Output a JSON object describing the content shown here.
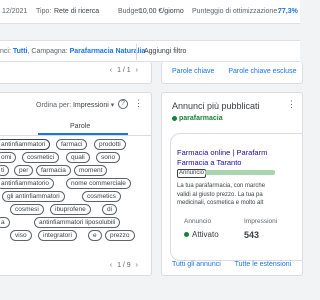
{
  "topbar": {
    "date_tail": "12/2021",
    "type_label": "Tipo:",
    "type_value": "Rete di ricerca",
    "budget_label": "Budget:",
    "budget_value": "10,00 €/giorno",
    "score_label": "Punteggio di ottimizzazione:",
    "score_value": "77,3%"
  },
  "filterbar": {
    "prefix": "nci:",
    "all": "Tutti",
    "campaign_label": "Campagna:",
    "campaign_value": "Parafarmacia Naturalia",
    "add_filter": "Aggiungi filtro"
  },
  "left_top": {
    "pager": "1 / 1",
    "prev": "‹",
    "next": "›"
  },
  "right_top": {
    "links": [
      "Parole chiave",
      "Parole chiave escluse"
    ]
  },
  "search_terms_card": {
    "sort_label": "Ordina per:",
    "sort_value": "Impressioni",
    "help_icon": "?",
    "more_icon": "⋮",
    "tabs": [
      "",
      "Parole"
    ],
    "words": [
      "antinfiammatori",
      "farmaci",
      "prodotti",
      "omi",
      "cosmetici",
      "quali",
      "sono",
      "ti",
      "per",
      "farmacia",
      "moment",
      "antinfiammatorio",
      "nome commerciale",
      "gli antinfiammatori",
      "cosmetics",
      "cosmesi",
      "ibuprofene",
      "di",
      "a",
      "antinfiammatori liposolubili",
      "viso",
      "integratori",
      "e",
      "prezzo"
    ],
    "pager": "1 / 9",
    "prev": "‹",
    "next": "›"
  },
  "top_ads_card": {
    "title": "Annunci più pubblicati",
    "campaign": "parafarmacia",
    "more_icon": "⋮",
    "ad": {
      "headline_line1": "Farmacia online | Parafarm",
      "headline_line2": "Farmacia a Taranto",
      "badge": "Annuncio",
      "desc_line1": "La tua parafarmacia, con marche",
      "desc_line2": "validi al giusto prezzo. La tua pa",
      "desc_line3": "medicinali, cosmetica e molto alt"
    },
    "status_label": "Annuncio",
    "status_value": "Attivato",
    "impressions_label": "Impressioni",
    "impressions_value": "543",
    "links": [
      "Tutti gli annunci",
      "Tutte le estensioni"
    ]
  },
  "colors": {
    "accent": "#1a73e8",
    "active_green": "#188038"
  }
}
